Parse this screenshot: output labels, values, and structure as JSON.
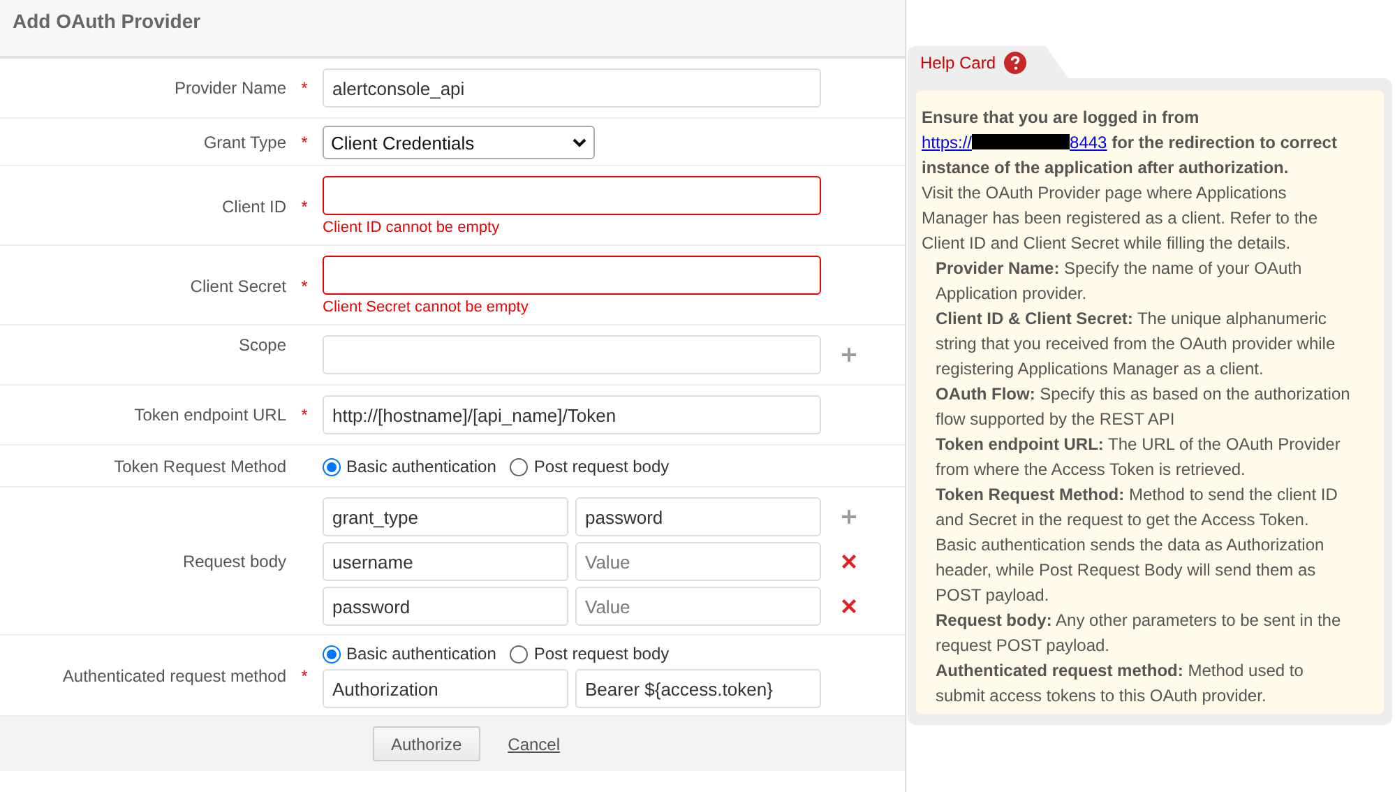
{
  "title": "Add OAuth Provider",
  "required_mark": "*",
  "fields": [
    {
      "kind": "text",
      "label": "Provider Name",
      "required": true,
      "value": "alertconsole_api"
    },
    {
      "kind": "select",
      "label": "Grant Type",
      "required": true,
      "value": "Client Credentials"
    },
    {
      "kind": "text",
      "label": "Client ID",
      "required": true,
      "error": "Client ID cannot be empty"
    },
    {
      "kind": "text",
      "label": "Client Secret",
      "required": true,
      "error": "Client Secret cannot be empty"
    },
    {
      "kind": "text",
      "label": "Scope",
      "required": false,
      "addable": true
    },
    {
      "kind": "text",
      "label": "Token endpoint URL",
      "required": true,
      "value": "http://[hostname]/[api_name]/Token"
    },
    {
      "kind": "radio",
      "label": "Token Request Method",
      "required": false,
      "options": [
        {
          "label": "Basic authentication",
          "selected": true
        },
        {
          "label": "Post request body",
          "selected": false
        }
      ]
    },
    {
      "kind": "pairs",
      "label": "Request body",
      "required": false,
      "rows": [
        {
          "kind": "add",
          "key": "grant_type",
          "value": "password"
        },
        {
          "kind": "remove",
          "key": "username",
          "placeholder": "Value"
        },
        {
          "kind": "remove",
          "key": "password",
          "placeholder": "Value"
        }
      ]
    },
    {
      "kind": "auth",
      "label": "Authenticated request method",
      "required": true,
      "options": [
        {
          "label": "Basic authentication",
          "selected": true
        },
        {
          "label": "Post request body",
          "selected": false
        }
      ],
      "key": "Authorization",
      "value": "Bearer ${access.token}"
    }
  ],
  "buttons": {
    "primary": "Authorize",
    "link": "Cancel"
  },
  "help": {
    "title": "Help Card",
    "intro_before": "Ensure that you are logged in from",
    "link_start": "https://",
    "link_end": "8443",
    "intro_after": "for the redirection to correct instance of the application after authorization.",
    "paragraph": "Visit the OAuth Provider page where Applications Manager has been registered as a client. Refer to the Client ID and Client Secret while filling the details.",
    "items": [
      "**Provider Name:** Specify the name of your OAuth Application provider.",
      "**Client ID & Client Secret:** The unique alphanumeric string that you received from the OAuth provider while registering Applications Manager as a client.",
      "**OAuth Flow:** Specify this as based on the authorization flow supported by the REST API",
      "**Token endpoint URL:** The URL of the OAuth Provider from where the Access Token is retrieved.",
      "**Token Request Method:** Method to send the client ID and Secret in the request to get the Access Token. Basic authentication sends the data as Authorization header, while Post Request Body will send them as POST payload.",
      "**Request body:** Any other parameters to be sent in the request POST payload.",
      "**Authenticated request method:** Method used to submit access tokens to this OAuth provider."
    ]
  }
}
